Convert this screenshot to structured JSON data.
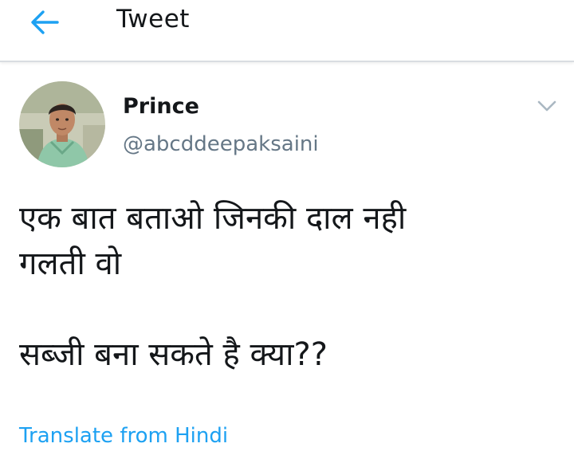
{
  "header": {
    "title": "Tweet",
    "back_icon": "arrow-left-icon",
    "accent_color": "#1da1f2"
  },
  "tweet": {
    "author_name": "Prince",
    "author_handle": "@abcddeepaksaini",
    "avatar_icon": "user-photo",
    "more_icon": "chevron-down-icon",
    "text_lines": [
      "एक बात बताओ जिनकी दाल नही",
      "गलती वो",
      "सब्जी बना सकते है क्या??"
    ],
    "translate_link": "Translate from Hindi"
  }
}
